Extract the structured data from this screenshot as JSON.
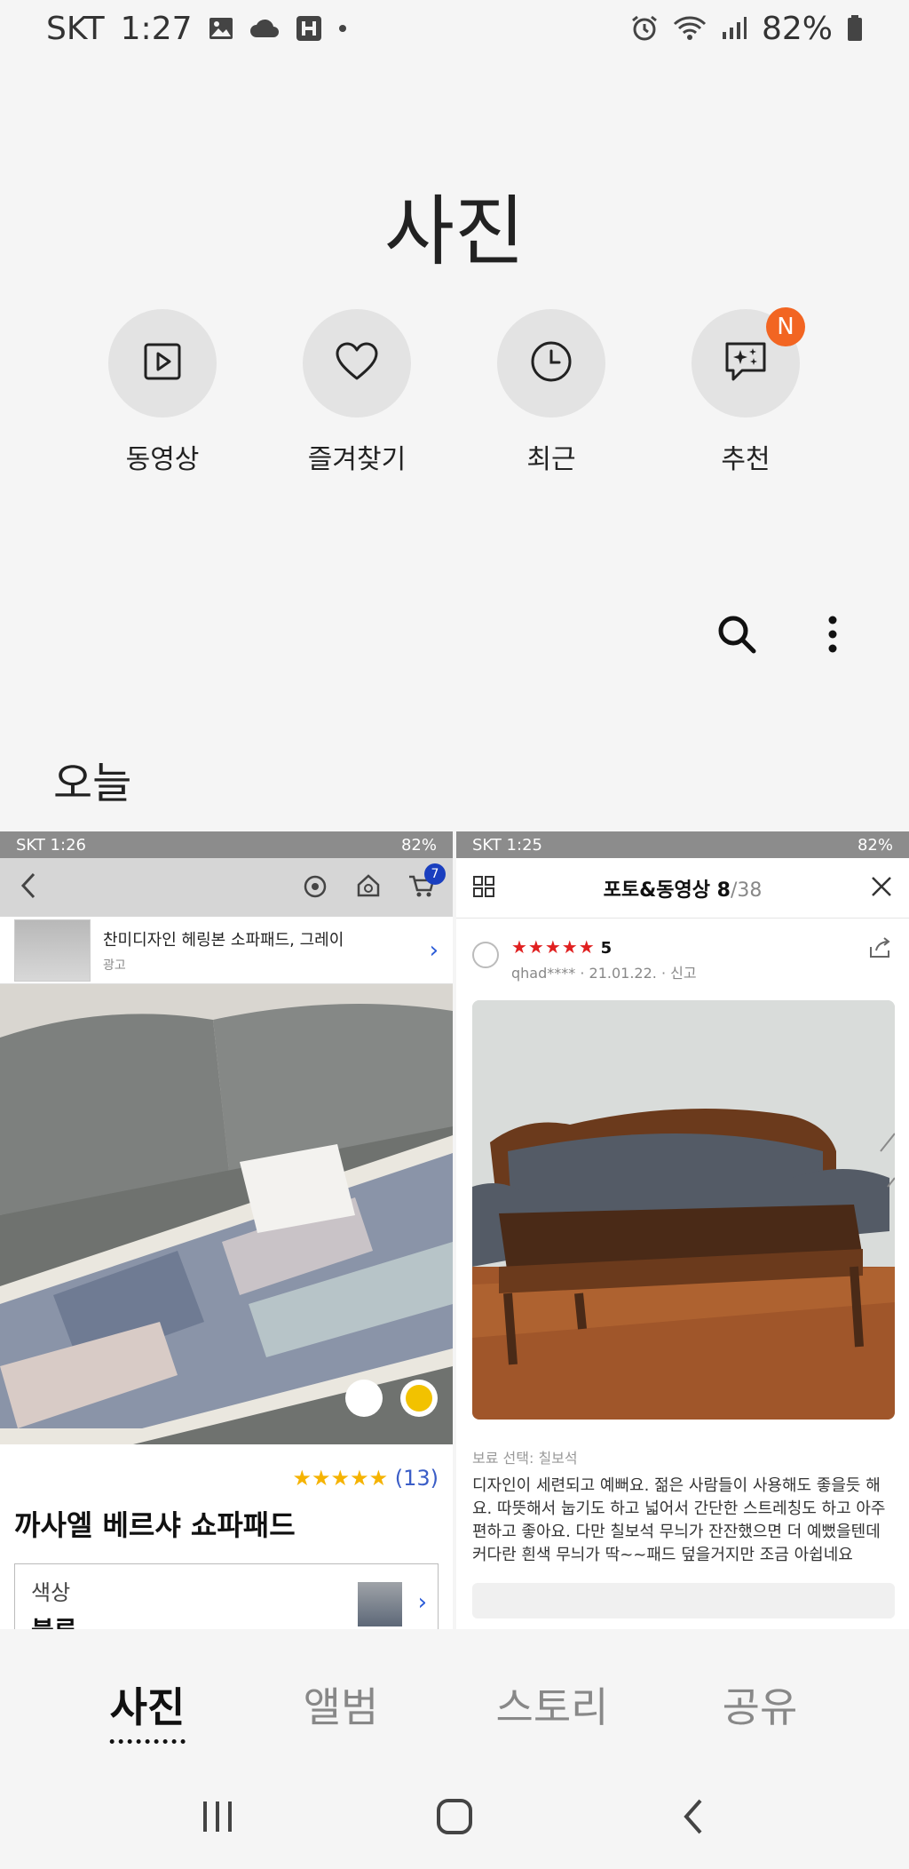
{
  "status_bar": {
    "carrier": "SKT",
    "time": "1:27",
    "battery": "82%",
    "icons": [
      "image-icon",
      "cloud-icon",
      "h-icon",
      "dot-icon",
      "alarm-icon",
      "wifi-icon",
      "signal-icon",
      "battery-icon"
    ]
  },
  "page": {
    "title": "사진"
  },
  "quick_actions": [
    {
      "label": "동영상",
      "icon": "video-icon"
    },
    {
      "label": "즐겨찾기",
      "icon": "heart-icon"
    },
    {
      "label": "최근",
      "icon": "clock-icon"
    },
    {
      "label": "추천",
      "icon": "sparkle-chat-icon",
      "badge": "N"
    }
  ],
  "tools": [
    "search-icon",
    "more-vertical-icon"
  ],
  "section": {
    "date_label": "오늘"
  },
  "thumbnails": {
    "left": {
      "status": {
        "carrier_time": "SKT 1:26",
        "battery": "82%"
      },
      "cart_count": "7",
      "ad": {
        "title": "찬미디자인 헤링본 소파패드, 그레이",
        "sub": "광고"
      },
      "rating": {
        "stars": "★★★★★",
        "count": "(13)"
      },
      "product_name": "까사엘 베르샤 쇼파패드",
      "option": {
        "label": "색상",
        "value": "블루"
      }
    },
    "right": {
      "status": {
        "carrier_time": "SKT 1:25",
        "battery": "82%"
      },
      "header": {
        "title": "포토&동영상",
        "current": "8",
        "total": "/38"
      },
      "review": {
        "stars": "★★★★★",
        "score": "5",
        "user": "qhad**** · 21.01.22. · 신고",
        "option": "보료 선택: 칠보석",
        "body": "디자인이 세련되고 예뻐요. 젊은 사람들이 사용해도 좋을듯 해요. 따뜻해서 눕기도 하고 넓어서 간단한 스트레칭도 하고 아주 편하고 좋아요. 다만 칠보석 무늬가 잔잔했으면 더 예뻤을텐데 커다란 흰색 무늬가 딱~~패드 덮을거지만 조금 아쉽네요"
      }
    }
  },
  "bottom_tabs": [
    {
      "label": "사진",
      "active": true
    },
    {
      "label": "앨범",
      "active": false
    },
    {
      "label": "스토리",
      "active": false
    },
    {
      "label": "공유",
      "active": false
    }
  ],
  "nav": [
    "recent-apps-icon",
    "home-icon",
    "back-icon"
  ],
  "colors": {
    "badge": "#f26522",
    "background": "#f5f5f5",
    "circle": "#e3e3e3"
  }
}
